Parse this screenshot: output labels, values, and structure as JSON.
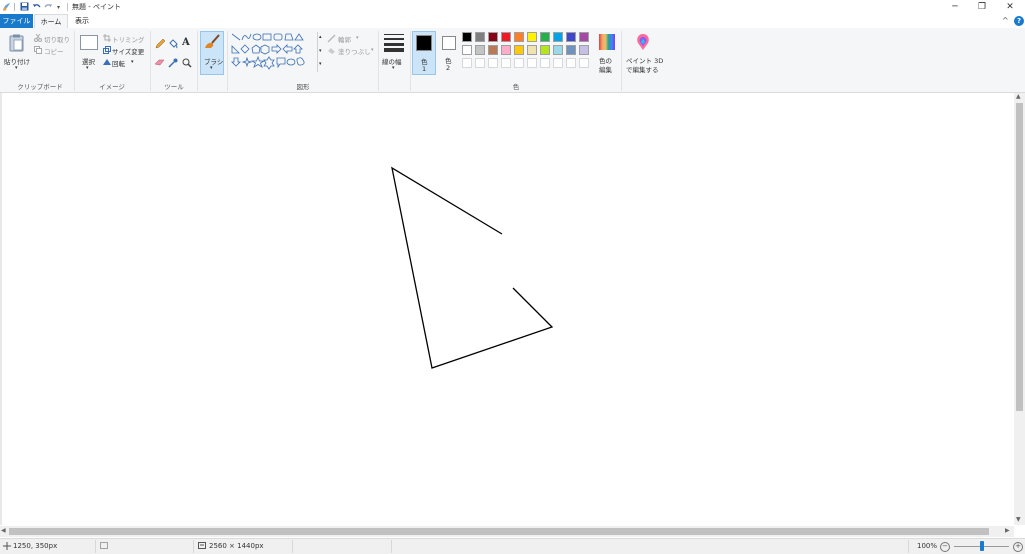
{
  "window": {
    "title": "無題 - ペイント",
    "minimize": "─",
    "restore": "❐",
    "close": "✕",
    "collapse_ribbon": "^",
    "help": "?"
  },
  "tabs": [
    {
      "label": "ファイル"
    },
    {
      "label": "ホーム"
    },
    {
      "label": "表示"
    }
  ],
  "clipboard": {
    "paste": "貼り付け",
    "cut": "切り取り",
    "copy": "コピー",
    "group": "クリップボード"
  },
  "image": {
    "select": "選択",
    "crop": "トリミング",
    "resize": "サイズ変更",
    "rotate": "回転",
    "group": "イメージ"
  },
  "tools": {
    "group": "ツール",
    "text_tool": "A"
  },
  "brush": {
    "label": "ブラシ"
  },
  "shapes": {
    "outline": "輪郭",
    "fill": "塗りつぶし",
    "group": "図形"
  },
  "size": {
    "label": "線の幅"
  },
  "colors": {
    "color1_label": "色",
    "color1_num": "1",
    "color2_label": "色",
    "color2_num": "2",
    "edit_line1": "色の",
    "edit_line2": "編集",
    "group": "色",
    "color1": "#000000",
    "color2": "#ffffff",
    "palette_row1": [
      "#000000",
      "#7f7f7f",
      "#880015",
      "#ed1c24",
      "#ff7f27",
      "#fff200",
      "#22b14c",
      "#00a2e8",
      "#3f48cc",
      "#a349a4"
    ],
    "palette_row2": [
      "#ffffff",
      "#c3c3c3",
      "#b97a57",
      "#ffaec9",
      "#ffc90e",
      "#efe4b0",
      "#b5e61d",
      "#99d9ea",
      "#7092be",
      "#c8bfe7"
    ]
  },
  "paint3d": {
    "line1": "ペイント 3D",
    "line2": "で編集する"
  },
  "drawing": {
    "stroke": "#000000",
    "shape": "triangle-outline"
  },
  "status": {
    "cursor_pos": "1250, 350px",
    "canvas_size": "2560 × 1440px",
    "zoom": "100%",
    "zoom_level": 1.0
  }
}
